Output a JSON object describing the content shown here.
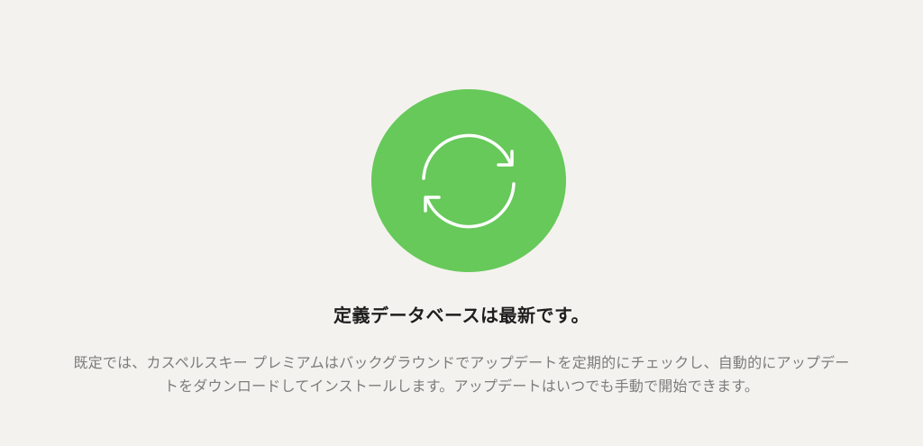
{
  "status": {
    "icon": "refresh-icon",
    "title": "定義データベースは最新です。",
    "description": "既定では、カスペルスキー プレミアムはバックグラウンドでアップデートを定期的にチェックし、自動的にアップデートをダウンロードしてインストールします。アップデートはいつでも手動で開始できます。"
  },
  "colors": {
    "background": "#f4f2ee",
    "status_circle": "#66c95a",
    "icon_stroke": "#ffffff",
    "title": "#1e1e1e",
    "description": "#7c7c7c"
  }
}
